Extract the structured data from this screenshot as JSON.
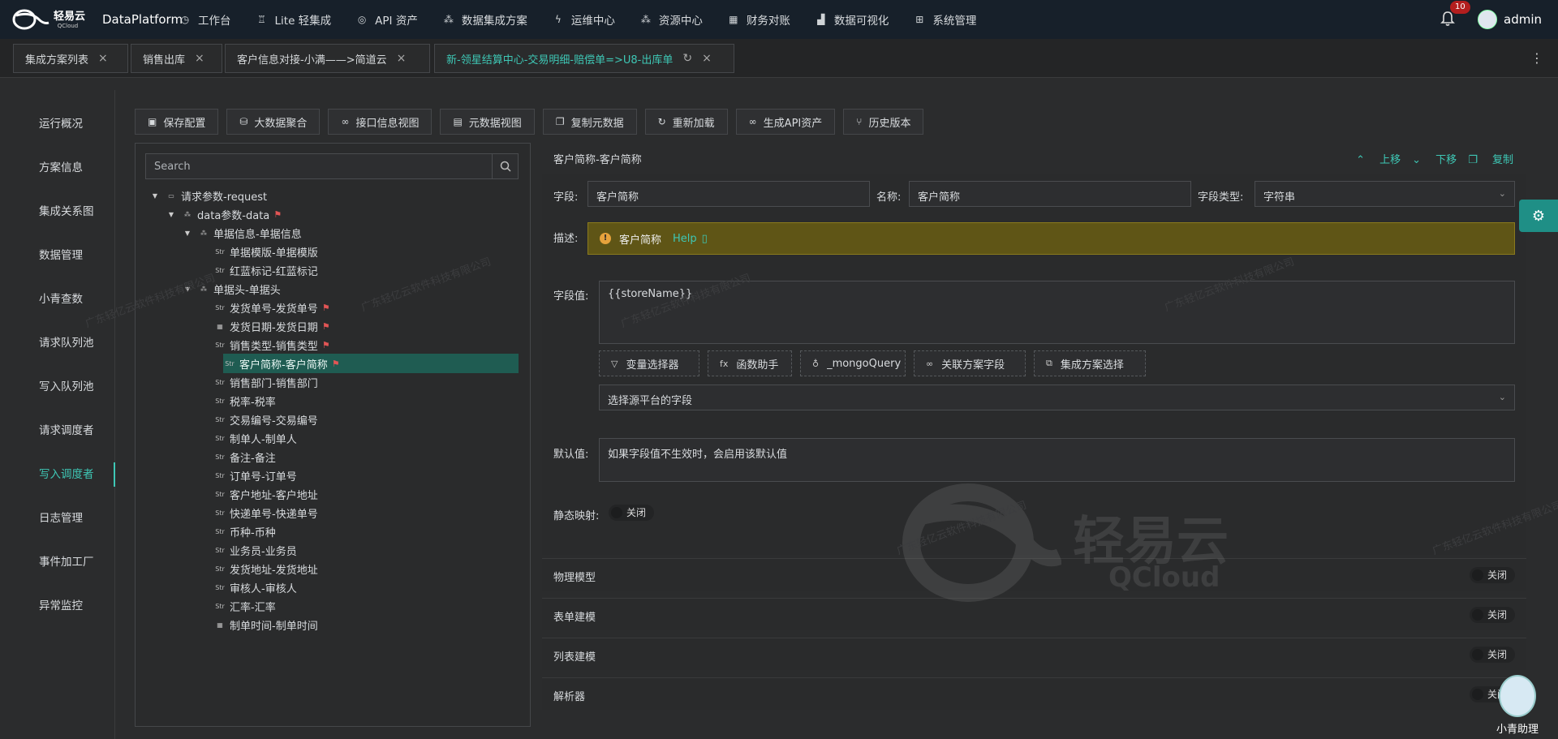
{
  "brand": {
    "logo_cn": "轻易云",
    "logo_en": "QCloud",
    "name": "DataPlatform"
  },
  "nav": [
    {
      "label": "工作台",
      "icon": "clock-icon"
    },
    {
      "label": "Lite 轻集成",
      "icon": "trophy-icon"
    },
    {
      "label": "API 资产",
      "icon": "compass-icon"
    },
    {
      "label": "数据集成方案",
      "icon": "network-icon"
    },
    {
      "label": "运维中心",
      "icon": "bolt-icon"
    },
    {
      "label": "资源中心",
      "icon": "network-icon"
    },
    {
      "label": "财务对账",
      "icon": "calculator-icon"
    },
    {
      "label": "数据可视化",
      "icon": "chart-icon"
    },
    {
      "label": "系统管理",
      "icon": "grid-icon"
    }
  ],
  "notifications": {
    "count": "10"
  },
  "user": {
    "name": "admin"
  },
  "tabs": [
    {
      "label": "集成方案列表"
    },
    {
      "label": "销售出库"
    },
    {
      "label": "客户信息对接-小满——>简道云"
    },
    {
      "label": "新-领星结算中心-交易明细-赔偿单=>U8-出库单"
    }
  ],
  "sidebar": [
    {
      "label": "运行概况"
    },
    {
      "label": "方案信息"
    },
    {
      "label": "集成关系图"
    },
    {
      "label": "数据管理"
    },
    {
      "label": "小青查数"
    },
    {
      "label": "请求队列池"
    },
    {
      "label": "写入队列池"
    },
    {
      "label": "请求调度者"
    },
    {
      "label": "写入调度者"
    },
    {
      "label": "日志管理"
    },
    {
      "label": "事件加工厂"
    },
    {
      "label": "异常监控"
    }
  ],
  "toolbar": [
    {
      "label": "保存配置"
    },
    {
      "label": "大数据聚合"
    },
    {
      "label": "接口信息视图"
    },
    {
      "label": "元数据视图"
    },
    {
      "label": "复制元数据"
    },
    {
      "label": "重新加载"
    },
    {
      "label": "生成API资产"
    },
    {
      "label": "历史版本"
    }
  ],
  "tree": {
    "search_placeholder": "Search",
    "nodes": [
      {
        "label": "请求参数-request"
      },
      {
        "label": "data参数-data"
      },
      {
        "label": "单据信息-单据信息"
      },
      {
        "label": "单据模版-单据模版"
      },
      {
        "label": "红蓝标记-红蓝标记"
      },
      {
        "label": "单据头-单据头"
      },
      {
        "label": "发货单号-发货单号"
      },
      {
        "label": "发货日期-发货日期"
      },
      {
        "label": "销售类型-销售类型"
      },
      {
        "label": "客户简称-客户简称"
      },
      {
        "label": "销售部门-销售部门"
      },
      {
        "label": "税率-税率"
      },
      {
        "label": "交易编号-交易编号"
      },
      {
        "label": "制单人-制单人"
      },
      {
        "label": "备注-备注"
      },
      {
        "label": "订单号-订单号"
      },
      {
        "label": "客户地址-客户地址"
      },
      {
        "label": "快递单号-快递单号"
      },
      {
        "label": "币种-币种"
      },
      {
        "label": "业务员-业务员"
      },
      {
        "label": "发货地址-发货地址"
      },
      {
        "label": "审核人-审核人"
      },
      {
        "label": "汇率-汇率"
      },
      {
        "label": "制单时间-制单时间"
      }
    ],
    "str_tag": "Str"
  },
  "detail": {
    "title": "客户简称-客户简称",
    "ops": {
      "up": "上移",
      "down": "下移",
      "copy": "复制"
    },
    "field_label": "字段:",
    "field_value": "客户简称",
    "name_label": "名称:",
    "name_value": "客户简称",
    "type_label": "字段类型:",
    "type_value": "字符串",
    "desc_label": "描述:",
    "desc_text": "客户简称",
    "desc_help": "Help",
    "value_label": "字段值:",
    "value_text": "{{storeName}}",
    "helpers": [
      {
        "label": "变量选择器"
      },
      {
        "label": "函数助手"
      },
      {
        "label": "_mongoQuery"
      },
      {
        "label": "关联方案字段"
      },
      {
        "label": "集成方案选择"
      }
    ],
    "source_placeholder": "选择源平台的字段",
    "default_label": "默认值:",
    "default_text": "如果字段值不生效时，会启用该默认值",
    "static_label": "静态映射:",
    "static_state": "关闭"
  },
  "sections": [
    {
      "label": "物理模型",
      "state": "关闭"
    },
    {
      "label": "表单建模",
      "state": "关闭"
    },
    {
      "label": "列表建模",
      "state": "关闭"
    },
    {
      "label": "解析器",
      "state": "关闭"
    }
  ],
  "assistant": {
    "label": "小青助理"
  },
  "watermark": {
    "text": "广东轻亿云软件科技有限公司",
    "logo_cn": "轻易云",
    "logo_en": "QCloud"
  }
}
